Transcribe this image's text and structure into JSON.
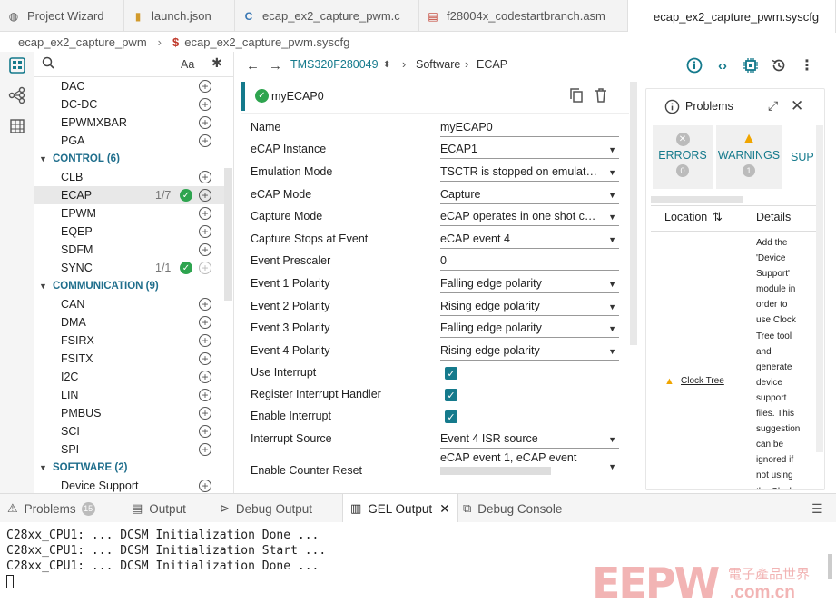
{
  "tabs": [
    {
      "label": "Project Wizard",
      "icon": "globe-icon"
    },
    {
      "label": "launch.json",
      "icon": "json-file-icon"
    },
    {
      "label": "ecap_ex2_capture_pwm.c",
      "icon": "c-file-icon"
    },
    {
      "label": "f28004x_codestartbranch.asm",
      "icon": "asm-file-icon"
    },
    {
      "label": "ecap_ex2_capture_pwm.syscfg",
      "icon": "syscfg-file-icon"
    }
  ],
  "breadcrumb": {
    "folder": "ecap_ex2_capture_pwm",
    "file": "ecap_ex2_capture_pwm.syscfg"
  },
  "search": {
    "case_label": "Aa"
  },
  "modules": {
    "top_items": [
      {
        "label": "DAC"
      },
      {
        "label": "DC-DC"
      },
      {
        "label": "EPWMXBAR"
      },
      {
        "label": "PGA"
      }
    ],
    "control": {
      "label": "CONTROL (6)",
      "items": [
        {
          "label": "CLB",
          "count": ""
        },
        {
          "label": "ECAP",
          "count": "1/7"
        },
        {
          "label": "EPWM",
          "count": ""
        },
        {
          "label": "EQEP",
          "count": ""
        },
        {
          "label": "SDFM",
          "count": ""
        },
        {
          "label": "SYNC",
          "count": "1/1"
        }
      ]
    },
    "communication": {
      "label": "COMMUNICATION (9)",
      "items": [
        {
          "label": "CAN"
        },
        {
          "label": "DMA"
        },
        {
          "label": "FSIRX"
        },
        {
          "label": "FSITX"
        },
        {
          "label": "I2C"
        },
        {
          "label": "LIN"
        },
        {
          "label": "PMBUS"
        },
        {
          "label": "SCI"
        },
        {
          "label": "SPI"
        }
      ]
    },
    "software": {
      "label": "SOFTWARE (2)",
      "items": [
        {
          "label": "Device Support"
        }
      ]
    }
  },
  "toolbar": {
    "device": "TMS320F280049",
    "path1": "Software",
    "path2": "ECAP"
  },
  "instance": {
    "name": "myECAP0"
  },
  "form": [
    {
      "label": "Name",
      "value": "myECAP0",
      "type": "text"
    },
    {
      "label": "eCAP Instance",
      "value": "ECAP1",
      "type": "select"
    },
    {
      "label": "Emulation Mode",
      "value": "TSCTR is stopped on emulat…",
      "type": "select"
    },
    {
      "label": "eCAP Mode",
      "value": "Capture",
      "type": "select"
    },
    {
      "label": "Capture Mode",
      "value": "eCAP operates in one shot c…",
      "type": "select"
    },
    {
      "label": "Capture Stops at Event",
      "value": "eCAP event 4",
      "type": "select"
    },
    {
      "label": "Event Prescaler",
      "value": "0",
      "type": "text"
    },
    {
      "label": "Event 1 Polarity",
      "value": "Falling edge polarity",
      "type": "select"
    },
    {
      "label": "Event 2 Polarity",
      "value": "Rising edge polarity",
      "type": "select"
    },
    {
      "label": "Event 3 Polarity",
      "value": "Falling edge polarity",
      "type": "select"
    },
    {
      "label": "Event 4 Polarity",
      "value": "Rising edge polarity",
      "type": "select"
    },
    {
      "label": "Use Interrupt",
      "value": "",
      "type": "check"
    },
    {
      "label": "Register Interrupt Handler",
      "value": "",
      "type": "check"
    },
    {
      "label": "Enable Interrupt",
      "value": "",
      "type": "check"
    },
    {
      "label": "Interrupt Source",
      "value": "Event 4 ISR source",
      "type": "select"
    },
    {
      "label": "Enable Counter Reset",
      "value": "eCAP event 1, eCAP event",
      "type": "multi"
    }
  ],
  "problems": {
    "title": "Problems",
    "errors": {
      "label": "ERRORS",
      "count": "0"
    },
    "warnings": {
      "label": "WARNINGS",
      "count": "1"
    },
    "sup_label": "SUP",
    "col_location": "Location",
    "col_details": "Details",
    "location_link": "Clock Tree",
    "details_lines": [
      "Add the",
      "'Device",
      "Support'",
      "module in",
      "order to",
      "use Clock",
      "Tree tool",
      "and",
      "generate",
      "device",
      "support",
      "files. This",
      "suggestion",
      "can be",
      "ignored if",
      "not using",
      "the Clock"
    ]
  },
  "bottom_tabs": [
    {
      "label": "Problems",
      "badge": "15",
      "icon": "warning-icon"
    },
    {
      "label": "Output",
      "icon": "output-icon"
    },
    {
      "label": "Debug Output",
      "icon": "debug-output-icon"
    },
    {
      "label": "GEL Output",
      "icon": "gel-icon"
    },
    {
      "label": "Debug Console",
      "icon": "console-icon"
    }
  ],
  "console_lines": [
    "C28xx_CPU1: ... DCSM Initialization Done ...",
    "C28xx_CPU1: ... DCSM Initialization Start ...",
    "C28xx_CPU1: ... DCSM Initialization Done ..."
  ],
  "watermark": {
    "logo": "EEPW",
    "cn": "電子產品世界",
    ".com": ".com.cn"
  }
}
